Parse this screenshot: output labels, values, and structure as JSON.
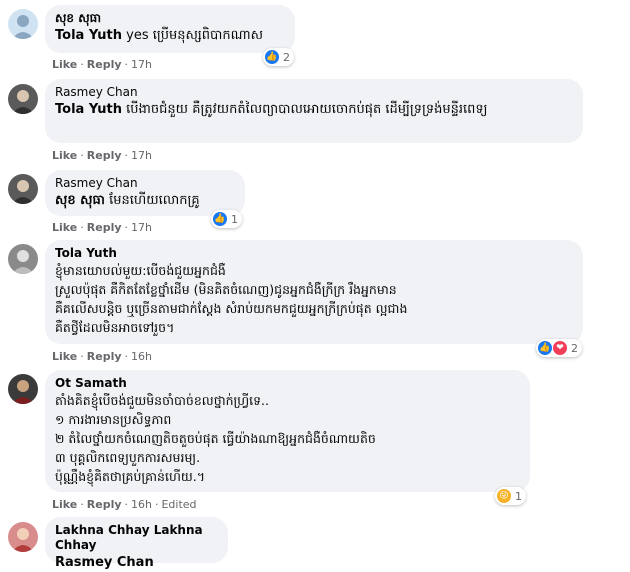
{
  "comments": [
    {
      "author": "សុខ សុធា",
      "mention": "Tola Yuth",
      "text": "yes ប្រើមនុស្សពិបាកណាស",
      "like": "Like",
      "reply": "Reply",
      "time": "17h",
      "reactions_count": "2",
      "avatar_color": "#cfe3f3"
    },
    {
      "author": "Rasmey Chan",
      "mention": "Tola Yuth",
      "text": "បើងាចជំនួយ គឺត្រូវយកតំលៃព្យាបាលអោយចោកប់ផុត ដើម្បីទ្រទ្រង់មន្ទីរពេទ្យ",
      "like": "Like",
      "reply": "Reply",
      "time": "17h",
      "avatar_color": "#5a5a5a"
    },
    {
      "author": "Rasmey Chan",
      "mention": "សុខ សុធា",
      "text": "មែនហើយលោកគ្រូ",
      "like": "Like",
      "reply": "Reply",
      "time": "17h",
      "reactions_count": "1",
      "avatar_color": "#5a5a5a"
    },
    {
      "author": "Tola Yuth",
      "text": "ខ្ញុំមានយោបល់មួយ:បើចង់ជួយអ្នកជំងឺ\nស្រួលប៉ុផុត គឺកិតតែខ្លែថ្នាំដើម (មិនគិតចំណេញ)ជូនអ្នកជំងឺក្រីក្រ រឺងអ្នកមាន\nគឺគលើសបន្តិច ឬច្រើនតាមជាក់ស្ដែង សំរាប់យកមកជួយអ្នកក្រីក្រប់ផុត ល្អជាង\nគឺតថ្វីដែលមិនអាចទៅរួច។",
      "like": "Like",
      "reply": "Reply",
      "time": "16h",
      "reactions_count": "2",
      "avatar_color": "#8a8a8a"
    },
    {
      "author": "Ot Samath",
      "text": "តាំងគិតខ្ញុំបើចង់ជួយមិនចាំបាច់ខលថ្នាក់ហ្វ្រីទេ..\n១ ការងារមានប្រសិទ្ធភាព\n២ តំលៃថ្នាំយកចំណេញតិចតួចប់ផុត ធ្វើយ៉ាងណាឱ្យអ្នកជំងឺចំណាយតិច\n៣ បុគ្គលិកពេទ្យបួកការសមរម្យ.\nប៉ុណ្ណឹងខ្ញុំគិតថាគ្រប់គ្រាន់ហើយ.។",
      "like": "Like",
      "reply": "Reply",
      "time": "16h",
      "edited": "Edited",
      "reactions_count": "1",
      "avatar_color": "#3b3b3b"
    },
    {
      "author": "Lakhna Chhay Lakhna Chhay",
      "mention": "Rasmey Chan",
      "avatar_color": "#d98c8c"
    }
  ]
}
